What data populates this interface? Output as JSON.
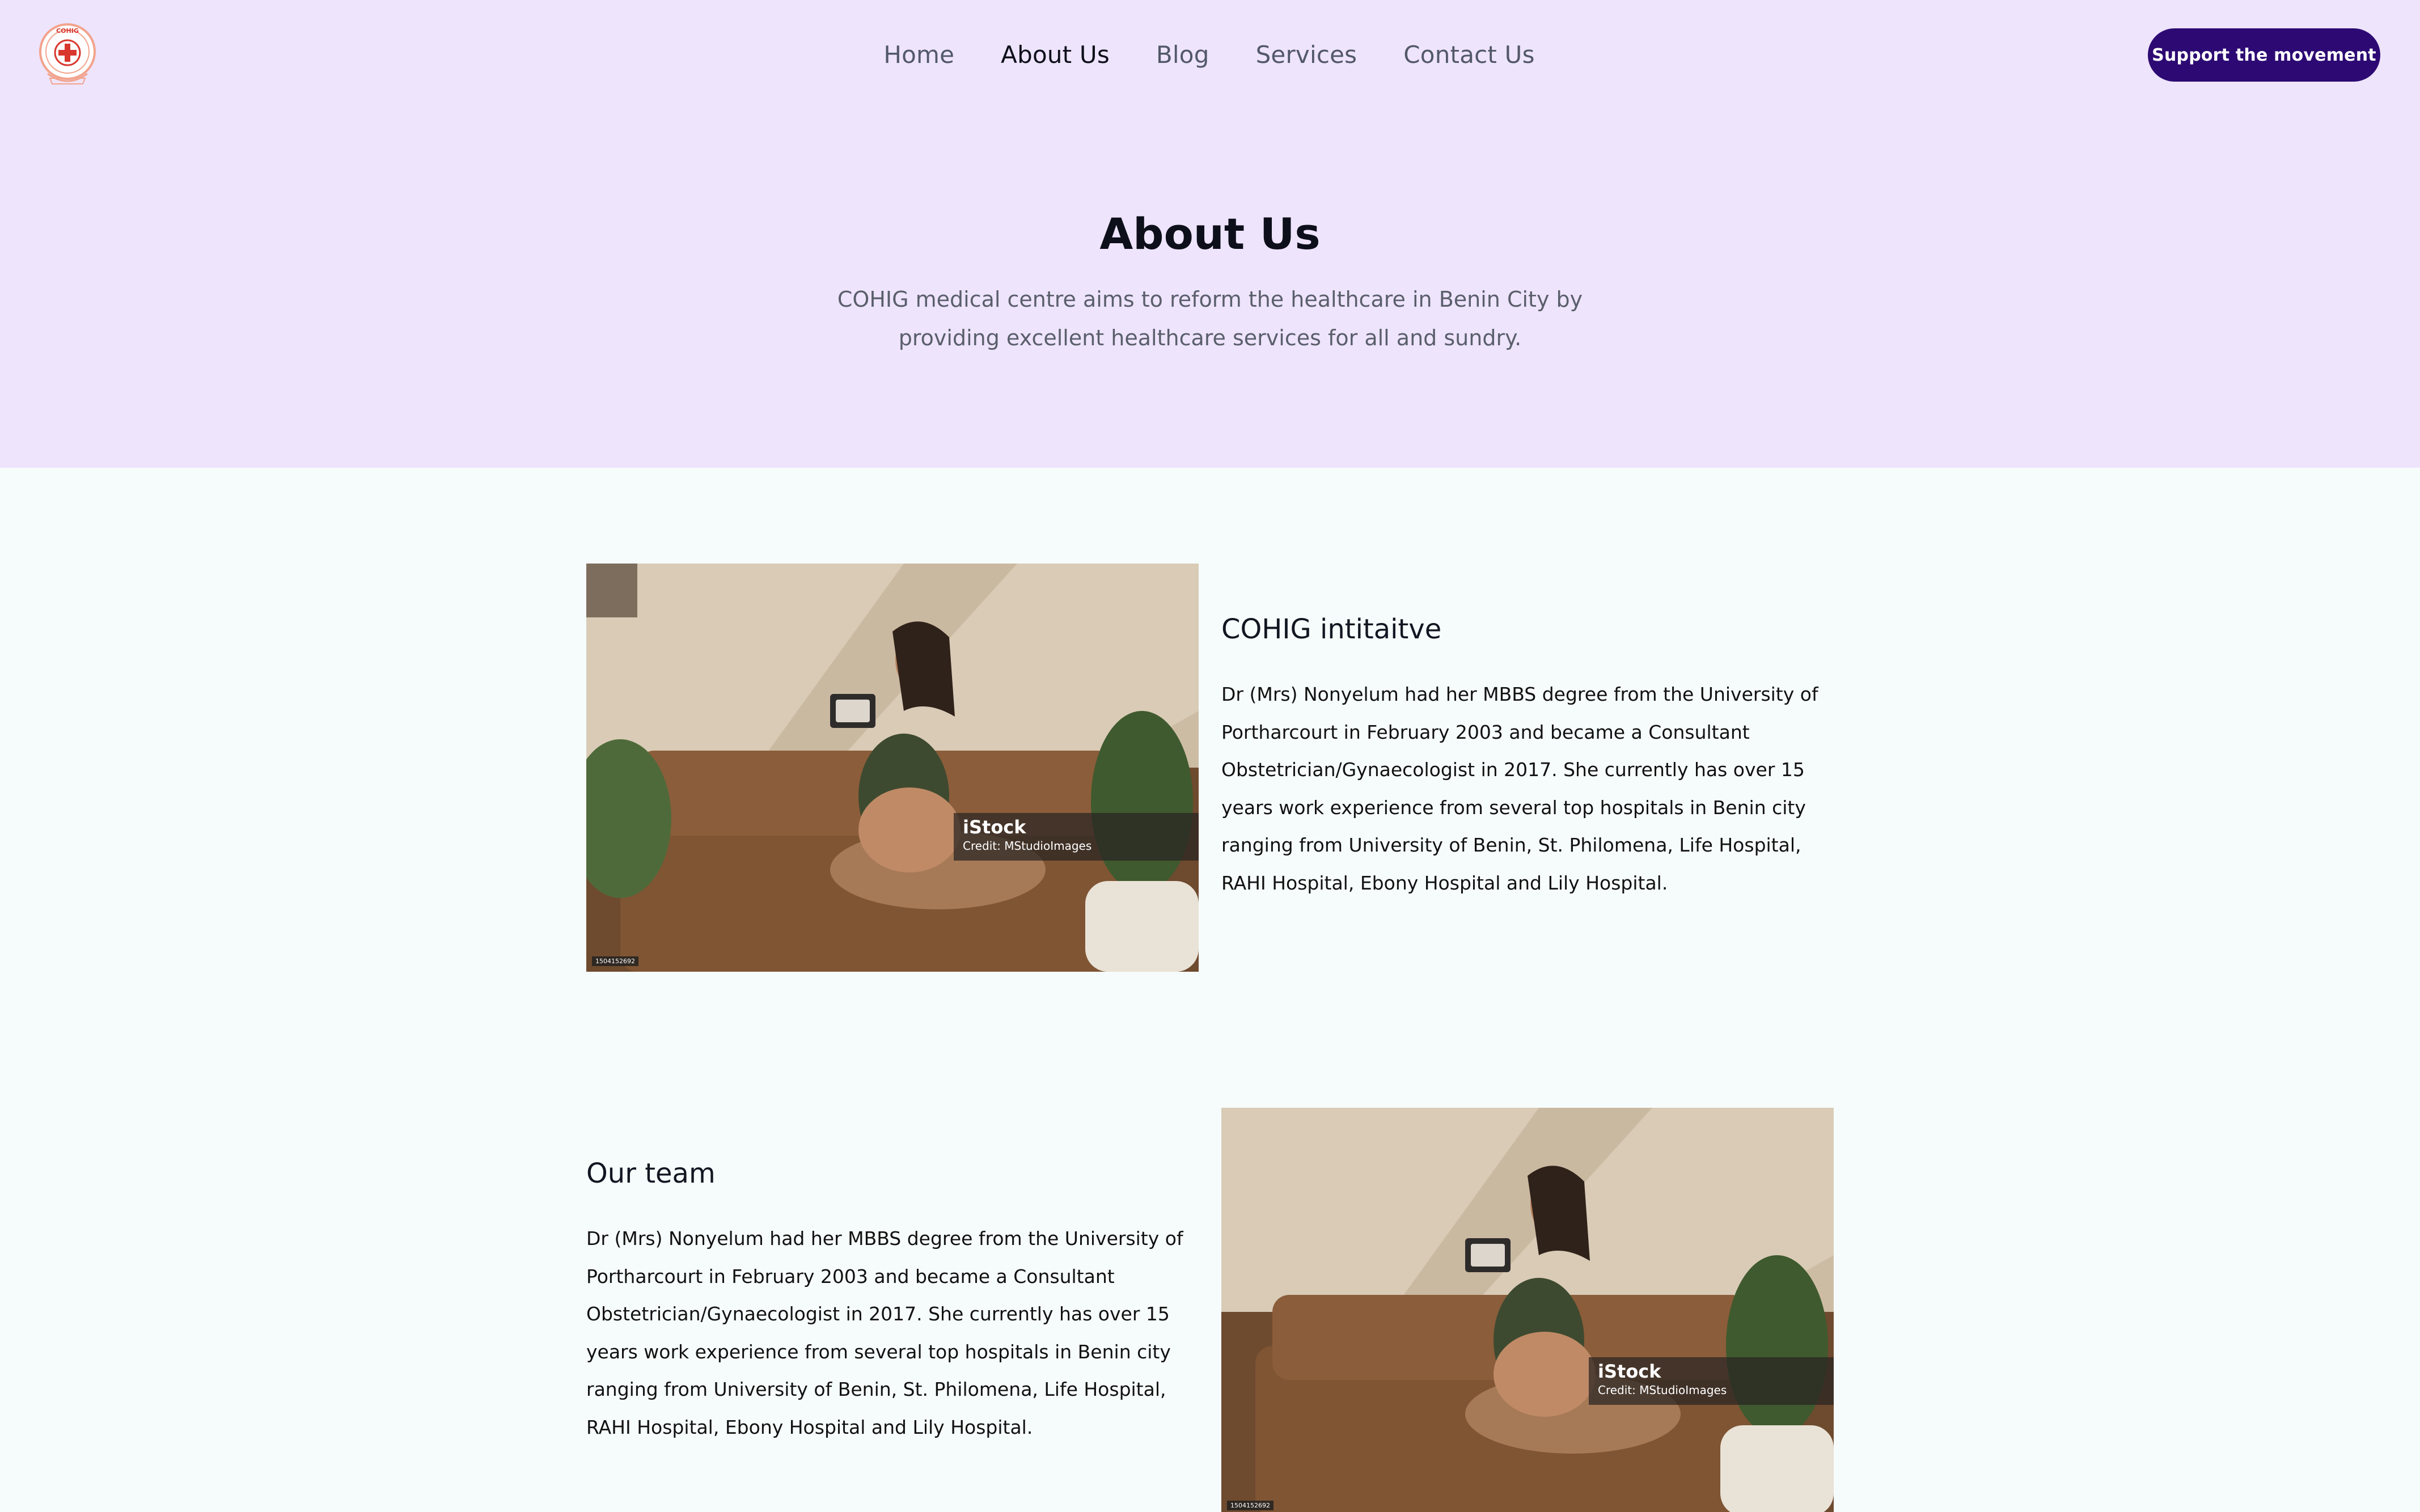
{
  "brand": {
    "logo_text_top": "COHIG",
    "logo_text_ring": "MEDICAL CENTRE",
    "logo_text_bottom": "",
    "logo_icon": "red-cross-icon",
    "colors": {
      "red": "#d8372d",
      "ring": "#f2a38d"
    }
  },
  "nav": {
    "items": [
      {
        "label": "Home",
        "active": false
      },
      {
        "label": "About Us",
        "active": true
      },
      {
        "label": "Blog",
        "active": false
      },
      {
        "label": "Services",
        "active": false
      },
      {
        "label": "Contact Us",
        "active": false
      }
    ]
  },
  "cta": {
    "label": "Support the movement",
    "color": "#2d0a73"
  },
  "hero": {
    "title": "About Us",
    "subtitle": "COHIG medical centre aims to reform the healthcare in Benin City by providing excellent healthcare services for all and sundry.",
    "background": "#eee4fc"
  },
  "sections": [
    {
      "title": "COHIG intitaitve",
      "text": "Dr (Mrs) Nonyelum had her MBBS degree from the University of Portharcourt in February 2003 and became a Consultant Obstetrician/Gynaecologist in 2017. She currently has over 15 years work experience from several top hospitals in Benin city ranging from University of Benin, St. Philomena, Life Hospital, RAHI Hospital, Ebony Hospital and Lily Hospital.",
      "image": {
        "watermark_brand": "iStock",
        "watermark_credit": "Credit: MStudioImages",
        "image_id": "1504152692"
      }
    },
    {
      "title": "Our team",
      "text": "Dr (Mrs) Nonyelum had her MBBS degree from the University of Portharcourt in February 2003 and became a Consultant Obstetrician/Gynaecologist in 2017. She currently has over 15 years work experience from several top hospitals in Benin city ranging from University of Benin, St. Philomena, Life Hospital, RAHI Hospital, Ebony Hospital and Lily Hospital.",
      "image": {
        "watermark_brand": "iStock",
        "watermark_credit": "Credit: MStudioImages",
        "image_id": "1504152692"
      }
    }
  ]
}
